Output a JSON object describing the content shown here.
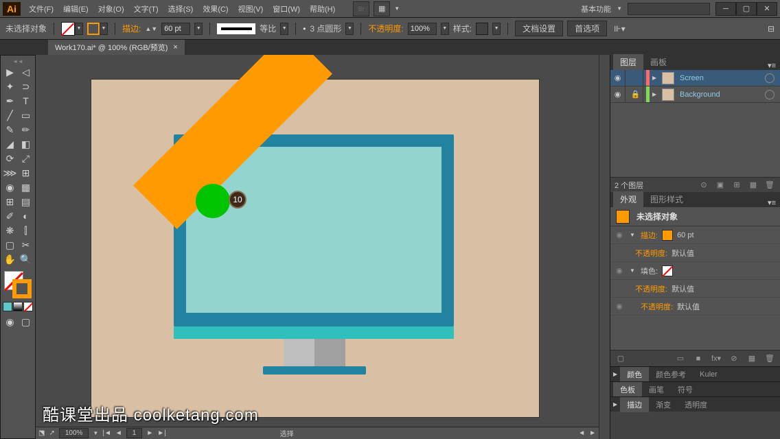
{
  "menubar": {
    "items": [
      "文件(F)",
      "编辑(E)",
      "对象(O)",
      "文字(T)",
      "选择(S)",
      "效果(C)",
      "视图(V)",
      "窗口(W)",
      "帮助(H)"
    ],
    "workspace": "基本功能"
  },
  "controlbar": {
    "no_selection": "未选择对象",
    "stroke_label": "描边:",
    "stroke_weight": "60 pt",
    "uniform_label": "等比",
    "profile_label": "3 点圆形",
    "opacity_label": "不透明度:",
    "opacity_value": "100%",
    "style_label": "样式:",
    "doc_setup": "文档设置",
    "preferences": "首选项"
  },
  "document": {
    "tab_title": "Work170.ai* @ 100% (RGB/预览)"
  },
  "canvas": {
    "badge_value": "10"
  },
  "statusbar": {
    "zoom": "100%",
    "page": "1",
    "tool_name": "选择"
  },
  "panels": {
    "layers_tab": "图层",
    "artboards_tab": "画板",
    "layers": [
      {
        "name": "Screen",
        "color": "#ff6b6b",
        "locked": false
      },
      {
        "name": "Background",
        "color": "#7ed957",
        "locked": true
      }
    ],
    "layer_count": "2 个图层",
    "appearance_tab": "外观",
    "gfx_styles_tab": "图形样式",
    "appearance": {
      "title": "未选择对象",
      "stroke_label": "描边:",
      "stroke_value": "60 pt",
      "opacity_label": "不透明度:",
      "opacity_default": "默认值",
      "fill_label": "填色:"
    },
    "color_tab": "颜色",
    "color_guide_tab": "颜色参考",
    "kuler_tab": "Kuler",
    "swatches_tab": "色板",
    "brushes_tab": "画笔",
    "symbols_tab": "符号",
    "stroke_tab": "描边",
    "gradient_tab": "渐变",
    "transparency_tab": "透明度"
  },
  "watermark": "酷课堂出品 coolketang.com"
}
